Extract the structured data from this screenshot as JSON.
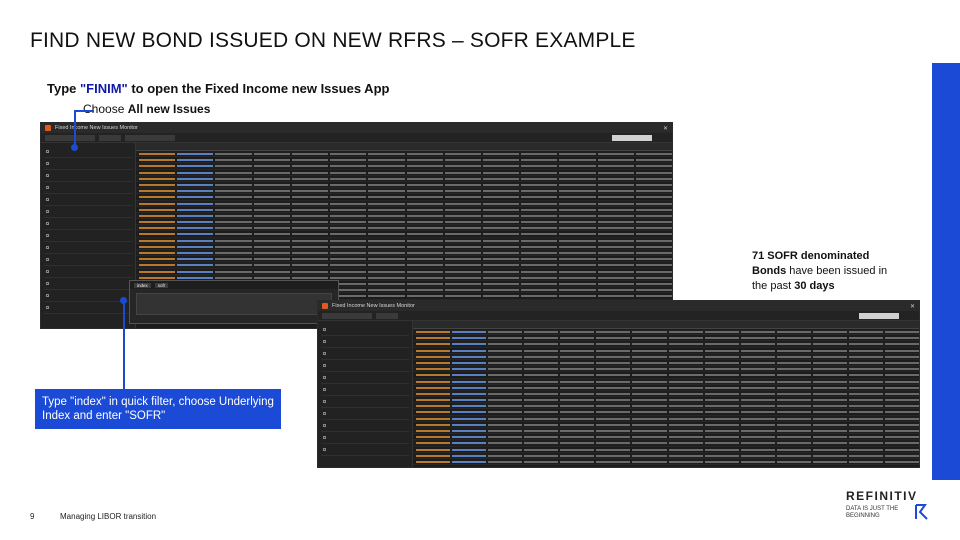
{
  "slide": {
    "title": "FIND NEW BOND ISSUED ON NEW RFRS – SOFR EXAMPLE",
    "instruction1_prefix": "Type ",
    "instruction1_quote": "\"FINIM\"",
    "instruction1_suffix": " to open the Fixed Income new Issues App",
    "instruction2_prefix": "Choose ",
    "instruction2_bold": "All new Issues",
    "callout_box": "Type \"index\" in quick filter, choose Underlying Index and enter \"SOFR\"",
    "sofr_count": "71 SOFR denominated",
    "sofr_bonds": "Bonds",
    "sofr_mid": " have been issued in the past ",
    "sofr_days": "30 days",
    "page_number": "9",
    "footer": "Managing LIBOR transition",
    "logo": "REFINITIV",
    "tagline": "DATA IS JUST THE BEGINNING",
    "colors": {
      "accent_blue": "#1b4bd6",
      "app_bg": "#1c1c1c",
      "app_orange": "#e05a1c"
    }
  },
  "screenshot1": {
    "window_title": "Fixed Income New Issues Monitor",
    "filter_value": "index",
    "filter_field": "sofr",
    "sidebar_items": [
      "",
      "",
      "",
      "",
      "",
      "",
      "",
      "",
      "",
      "",
      "",
      "",
      "",
      ""
    ],
    "rows": 26
  },
  "screenshot2": {
    "window_title": "Fixed Income New Issues Monitor",
    "sidebar_items": [
      "",
      "",
      "",
      "",
      "",
      "",
      "",
      "",
      "",
      "",
      ""
    ],
    "rows": 22
  }
}
